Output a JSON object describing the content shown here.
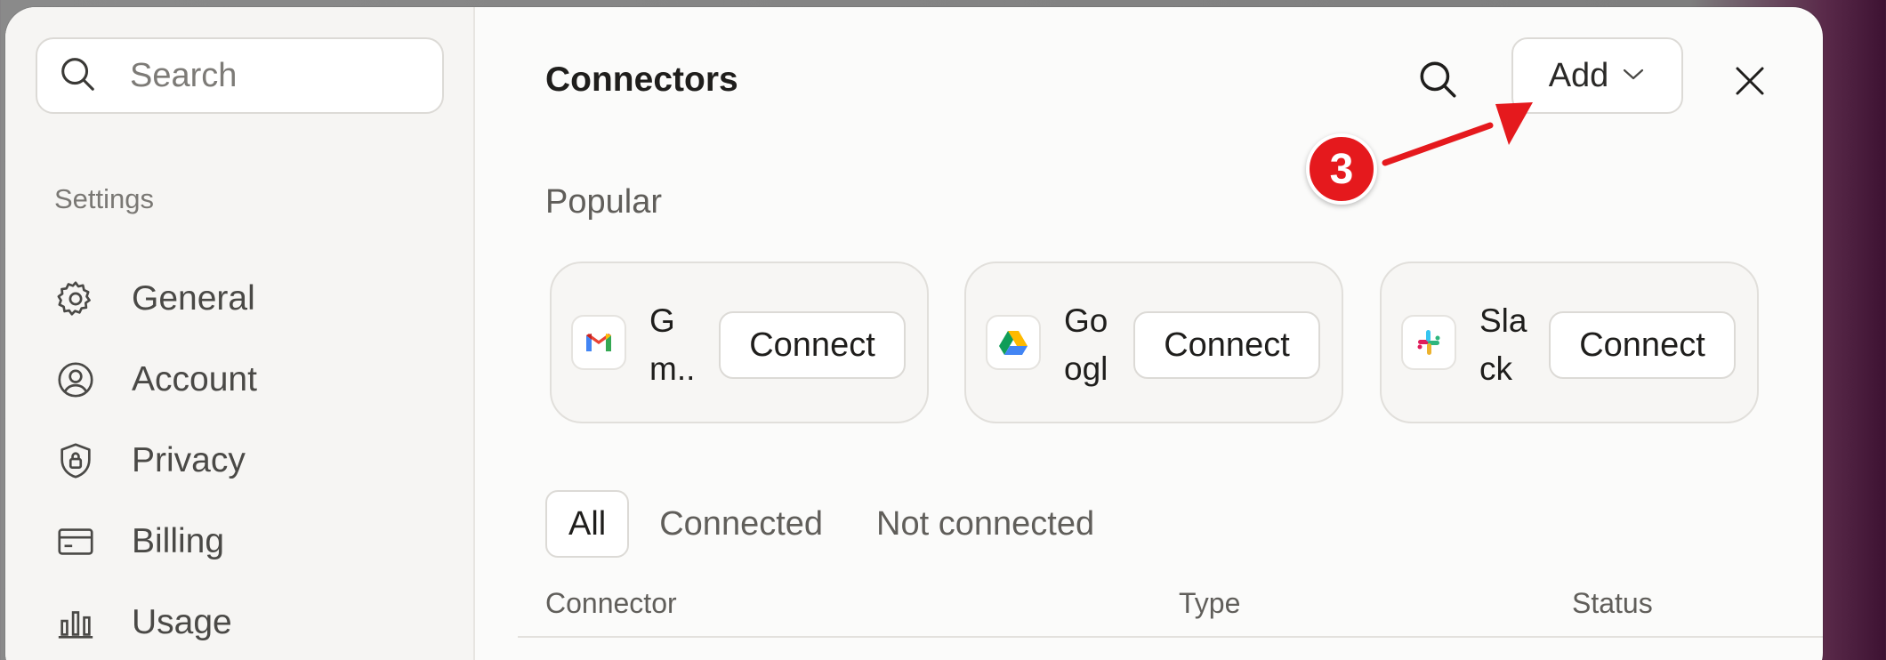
{
  "sidebar": {
    "search_placeholder": "Search",
    "section_label": "Settings",
    "items": [
      {
        "label": "General",
        "icon": "gear-icon"
      },
      {
        "label": "Account",
        "icon": "user-circle-icon"
      },
      {
        "label": "Privacy",
        "icon": "shield-lock-icon"
      },
      {
        "label": "Billing",
        "icon": "credit-card-icon"
      },
      {
        "label": "Usage",
        "icon": "bar-chart-icon"
      }
    ]
  },
  "header": {
    "title": "Connectors",
    "add_label": "Add",
    "search_icon": "search-icon",
    "close_icon": "close-icon"
  },
  "popular": {
    "label": "Popular",
    "cards": [
      {
        "name": "G m..",
        "logo": "gmail-icon",
        "action": "Connect"
      },
      {
        "name": "Go ogl",
        "logo": "google-drive-icon",
        "action": "Connect"
      },
      {
        "name": "Sla ck",
        "logo": "slack-icon",
        "action": "Connect"
      }
    ]
  },
  "tabs": [
    "All",
    "Connected",
    "Not connected"
  ],
  "table": {
    "columns": [
      "Connector",
      "Type",
      "Status"
    ]
  },
  "annotation": {
    "step": "3",
    "color": "#e5191d"
  }
}
